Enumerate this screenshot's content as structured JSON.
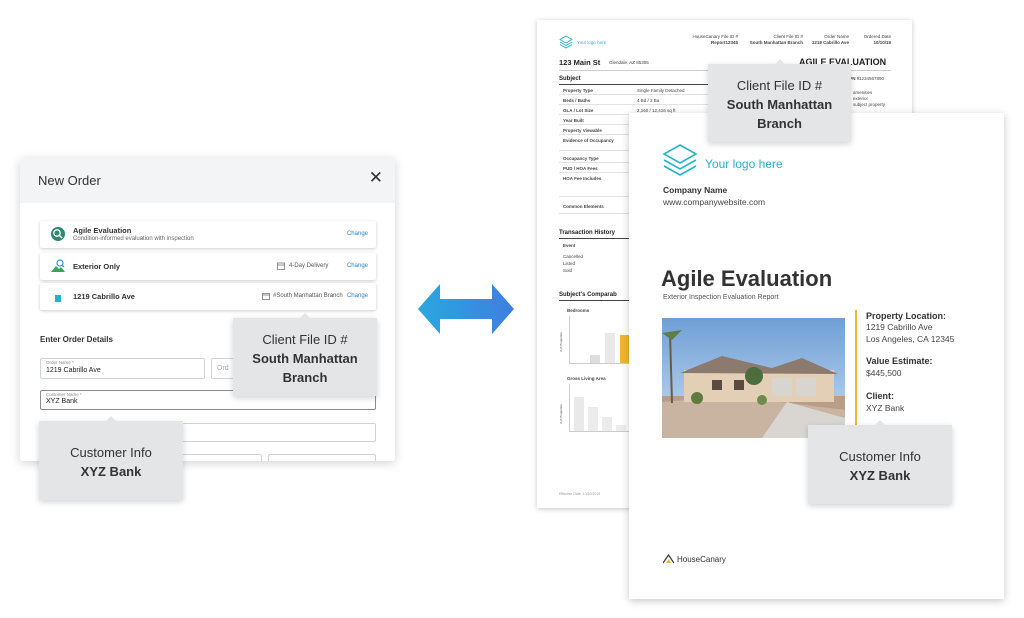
{
  "order_modal": {
    "title": "New Order",
    "close_glyph": "✕",
    "products": [
      {
        "name": "Agile Evaluation",
        "subtitle": "Condition-informed evaluation with inspection",
        "change": "Change",
        "icon": "evaluation-icon"
      },
      {
        "name": "Exterior Only",
        "delivery": "4-Day Delivery",
        "change": "Change",
        "icon": "exterior-icon"
      },
      {
        "name": "1219 Cabrillo Ave",
        "branch": "#South Manhattan Branch",
        "change": "Change",
        "icon": "house-icon"
      }
    ],
    "section_title": "Enter Order Details",
    "order_name_label": "Order Name *",
    "order_name_value": "1219 Cabrillo Ave",
    "order_field2_placeholder": "Ord",
    "customer_name_label": "Customer Name *",
    "customer_name_value": "XYZ Bank"
  },
  "tooltips": {
    "client_file_left": {
      "line1": "Client File ID #",
      "line2": "South Manhattan",
      "line3": "Branch"
    },
    "customer_info_left": {
      "line1": "Customer Info",
      "line2": "XYZ Bank"
    },
    "client_file_right": {
      "line1": "Client File ID #",
      "line2": "South Manhattan",
      "line3": "Branch"
    },
    "customer_info_right": {
      "line1": "Customer Info",
      "line2": "XYZ Bank"
    }
  },
  "back_report": {
    "logo_text": "Your logo here",
    "header_cols": [
      {
        "label": "HouseCanary File ID #",
        "value": "Report12345"
      },
      {
        "label": "Client File ID #",
        "value": "South Manhattan Branch"
      },
      {
        "label": "Order Name",
        "value": "1219 Cabrillo Ave"
      },
      {
        "label": "Ordered Date",
        "value": "10/10/19"
      }
    ],
    "address": "123 Main St",
    "city": "Glendale, AZ 85305",
    "heading": "AGILE EVALUATION",
    "apn_label": "APN #",
    "apn_value": "1234567890",
    "subject_title": "Subject",
    "subject_rows": [
      {
        "label": "Property Type",
        "value": "Single Family Detached"
      },
      {
        "label": "Beds / Baths",
        "value": "4 Bd / 3 Ba"
      },
      {
        "label": "GLA / Lot Size",
        "value": "2,160 / 12,416 sq ft"
      },
      {
        "label": "Year Built",
        "value": ""
      },
      {
        "label": "Property Viewable",
        "value": ""
      },
      {
        "label": "Evidence of Occupancy",
        "value": ""
      },
      {
        "label": "Occupancy Type",
        "value": ""
      },
      {
        "label": "PUD / HOA Fees",
        "value": ""
      },
      {
        "label": "HOA Fee Includes",
        "value": ""
      },
      {
        "label": "Common Elements",
        "value": ""
      }
    ],
    "side_notes": [
      "amenities",
      "exterior",
      "subject property"
    ],
    "transaction_title": "Transaction History",
    "transaction_header": "Event",
    "transaction_events": [
      "Cancelled",
      "Listed",
      "Sold"
    ],
    "comparables_title": "Subject's Comparab",
    "bedrooms_title": "Bedrooms",
    "gla_title": "Gross Living Area",
    "y_axis_label": "# of Properties",
    "footer_note": "Effective Date: 10/10/2019"
  },
  "front_report": {
    "logo_text": "Your logo here",
    "company_name": "Company Name",
    "company_website": "www.companywebsite.com",
    "title": "Agile Evaluation",
    "subtitle": "Exterior Inspection Evaluation Report",
    "property_location_label": "Property Location:",
    "property_location_line1": "1219 Cabrillo Ave",
    "property_location_line2": "Los Angeles, CA 12345",
    "value_estimate_label": "Value Estimate:",
    "value_estimate": "$445,500",
    "client_label": "Client:",
    "client_value": "XYZ Bank",
    "brand": "HouseCanary"
  },
  "colors": {
    "accent_teal": "#21b4c9",
    "arrow_blue": "#2e93da",
    "gold": "#f2b632",
    "link_blue": "#2f7fd1",
    "tooltip_bg": "#e4e5e6"
  }
}
